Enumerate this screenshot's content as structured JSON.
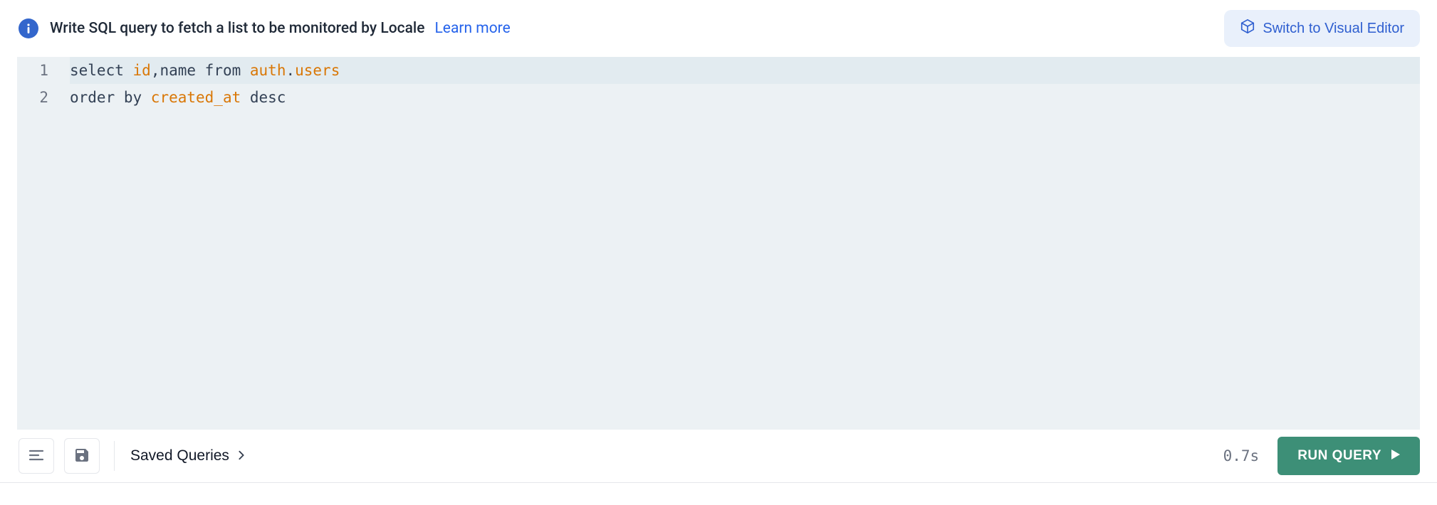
{
  "header": {
    "info_text": "Write SQL query to fetch a list to be monitored by Locale",
    "learn_more": "Learn more",
    "switch_label": "Switch to Visual Editor"
  },
  "editor": {
    "lines": [
      {
        "num": "1",
        "tokens": [
          {
            "t": "select ",
            "c": "plain"
          },
          {
            "t": "id",
            "c": "ident"
          },
          {
            "t": ",name from ",
            "c": "plain"
          },
          {
            "t": "auth",
            "c": "ident"
          },
          {
            "t": ".",
            "c": "plain"
          },
          {
            "t": "users",
            "c": "ident"
          }
        ],
        "current": true
      },
      {
        "num": "2",
        "tokens": [
          {
            "t": "order by ",
            "c": "plain"
          },
          {
            "t": "created_at",
            "c": "ident"
          },
          {
            "t": " desc",
            "c": "plain"
          }
        ],
        "current": false
      }
    ]
  },
  "footer": {
    "saved_queries_label": "Saved Queries",
    "timer": "0.7s",
    "run_label": "RUN QUERY"
  }
}
